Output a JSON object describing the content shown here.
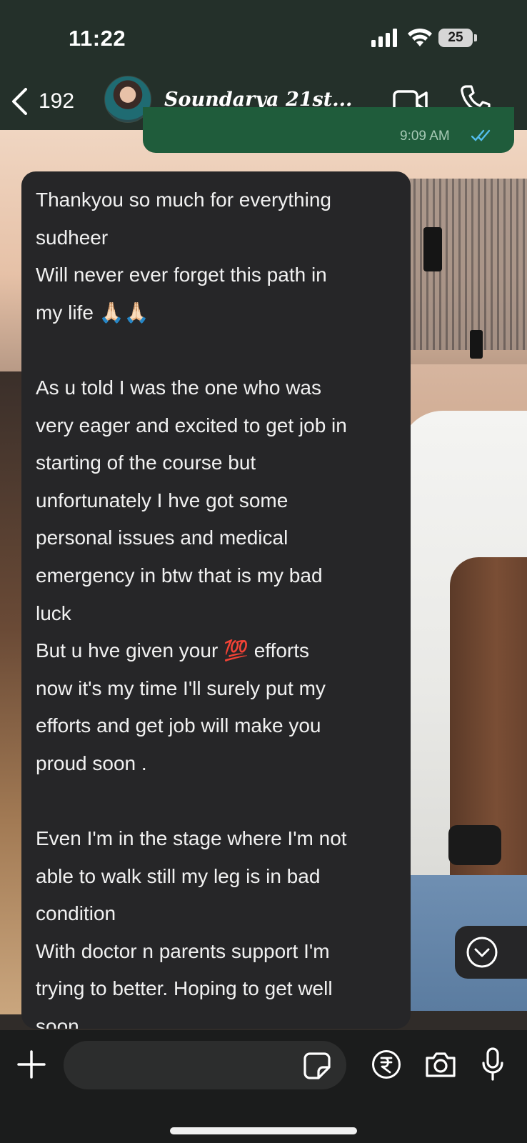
{
  "status_bar": {
    "time": "11:22",
    "battery": "25"
  },
  "header": {
    "back_count": "192",
    "contact_name": "Soundarya 21st...",
    "icons": [
      "chevron-left-icon",
      "video-call-icon",
      "phone-icon"
    ]
  },
  "messages": {
    "outgoing_time": "9:09 AM",
    "incoming_text": "Thankyou so much for everything\nsudheer\nWill never ever forget this path in\nmy life 🙏🏻🙏🏻\n\nAs u told I was the one who was\nvery eager and excited to get job in\nstarting of the course but\nunfortunately I hve got some\npersonal issues and medical\nemergency in btw that is my bad\nluck\nBut u hve given your 💯 efforts\nnow it's my time I'll surely put my\nefforts and get job will make you\nproud soon .\n\nEven I'm in the stage where I'm not\nable to walk still my leg is in bad\ncondition\nWith doctor n parents support I'm\ntrying to better. Hoping to get well\nsoon..."
  },
  "composer": {
    "input_value": "",
    "icons": [
      "plus-icon",
      "sticker-icon",
      "rupee-icon",
      "camera-icon",
      "microphone-icon"
    ]
  },
  "colors": {
    "header_bg": "#24302a",
    "outgoing_bubble": "#1f5c3b",
    "incoming_bubble": "#262628",
    "read_ticks": "#53bdeb",
    "composer_bg": "#1b1c1c"
  }
}
